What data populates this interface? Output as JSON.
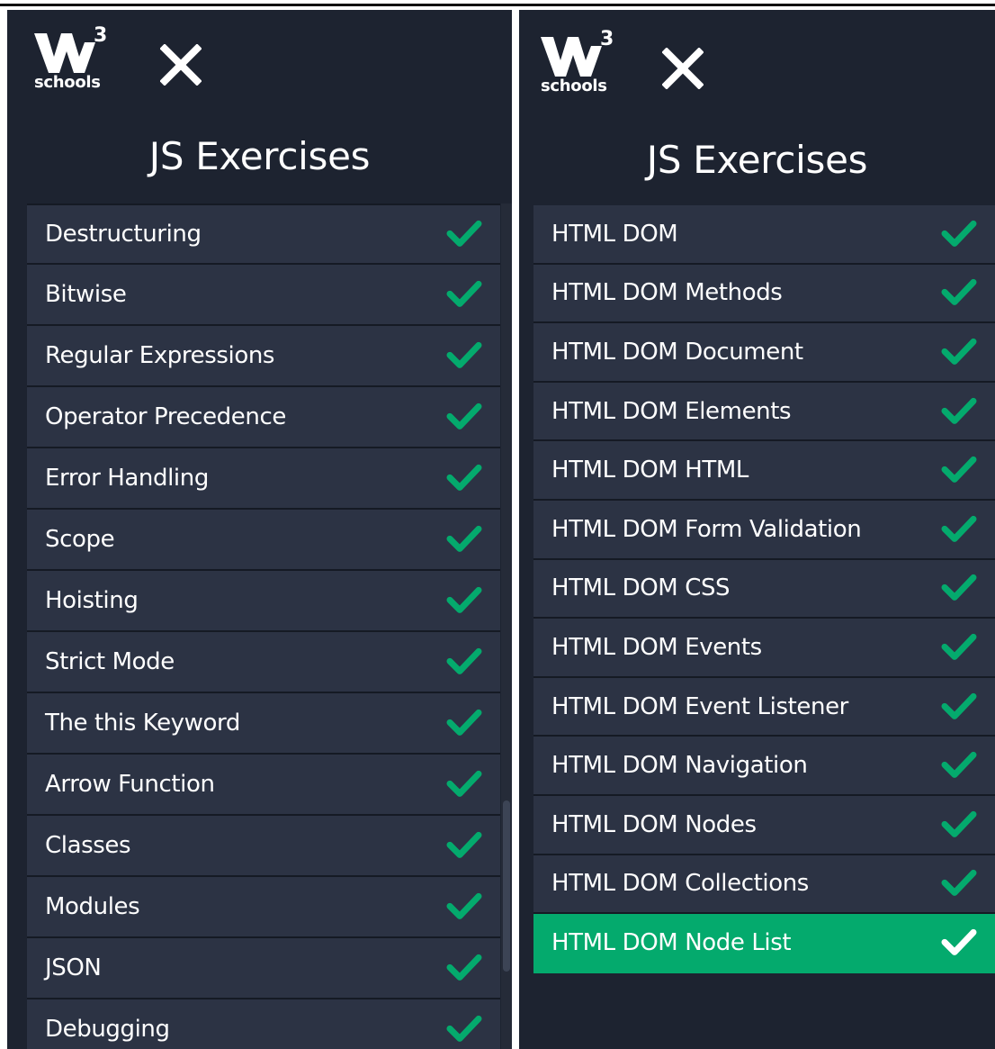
{
  "colors": {
    "panel_bg": "#1d2330",
    "item_bg": "#2c3344",
    "active_bg": "#04aa6d",
    "check_green": "#04aa6d",
    "check_white": "#ffffff"
  },
  "logo": {
    "superscript": "3",
    "word": "schools"
  },
  "left_panel": {
    "title": "JS Exercises",
    "items": [
      {
        "label": "Destructuring",
        "completed": true
      },
      {
        "label": "Bitwise",
        "completed": true
      },
      {
        "label": "Regular Expressions",
        "completed": true
      },
      {
        "label": "Operator Precedence",
        "completed": true
      },
      {
        "label": "Error Handling",
        "completed": true
      },
      {
        "label": "Scope",
        "completed": true
      },
      {
        "label": "Hoisting",
        "completed": true
      },
      {
        "label": "Strict Mode",
        "completed": true
      },
      {
        "label": "The this Keyword",
        "completed": true
      },
      {
        "label": "Arrow Function",
        "completed": true
      },
      {
        "label": "Classes",
        "completed": true
      },
      {
        "label": "Modules",
        "completed": true
      },
      {
        "label": "JSON",
        "completed": true
      },
      {
        "label": "Debugging",
        "completed": true
      }
    ]
  },
  "right_panel": {
    "title": "JS Exercises",
    "items": [
      {
        "label": "HTML DOM",
        "completed": true
      },
      {
        "label": "HTML DOM Methods",
        "completed": true
      },
      {
        "label": "HTML DOM Document",
        "completed": true
      },
      {
        "label": "HTML DOM Elements",
        "completed": true
      },
      {
        "label": "HTML DOM HTML",
        "completed": true
      },
      {
        "label": "HTML DOM Form Validation",
        "completed": true
      },
      {
        "label": "HTML DOM CSS",
        "completed": true
      },
      {
        "label": "HTML DOM Events",
        "completed": true
      },
      {
        "label": "HTML DOM Event Listener",
        "completed": true
      },
      {
        "label": "HTML DOM Navigation",
        "completed": true
      },
      {
        "label": "HTML DOM Nodes",
        "completed": true
      },
      {
        "label": "HTML DOM Collections",
        "completed": true
      },
      {
        "label": "HTML DOM Node List",
        "completed": true,
        "active": true
      }
    ]
  }
}
